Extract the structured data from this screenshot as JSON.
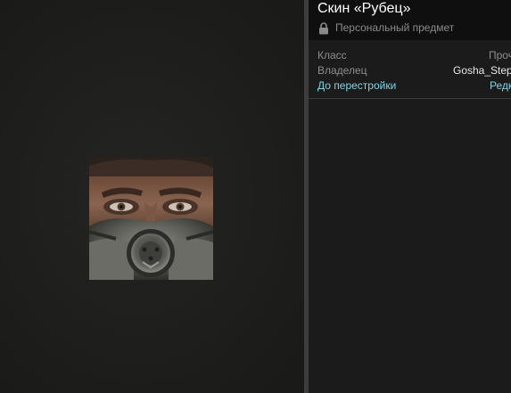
{
  "item": {
    "title": "Скин «Рубец»",
    "subtitle": "Персональный предмет",
    "lock_icon": "lock-icon"
  },
  "stats": [
    {
      "key": "Класс",
      "value": "Проч"
    },
    {
      "key": "Владелец",
      "value": "Gosha_Step"
    },
    {
      "key": "До перестройки",
      "value": "Редк"
    }
  ],
  "preview": {
    "image": "character-portrait-gas-mask"
  },
  "colors": {
    "accent": "#7fd3e6",
    "header_bg": "#0f0f0f",
    "panel_bg": "#1b1b1b"
  }
}
